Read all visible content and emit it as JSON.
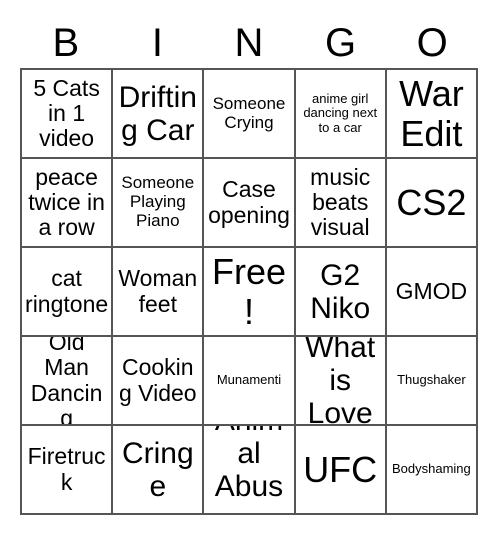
{
  "header": {
    "letters": [
      "B",
      "I",
      "N",
      "G",
      "O"
    ]
  },
  "colors": {
    "border": "#555555",
    "text": "#000000",
    "background": "#ffffff"
  },
  "grid": {
    "rows": 5,
    "columns": 5,
    "cells": [
      {
        "text": "5 Cats in 1 video",
        "size": "s-md"
      },
      {
        "text": "Drifting Car",
        "size": "s-lg"
      },
      {
        "text": "Someone Crying",
        "size": "s-sm"
      },
      {
        "text": "anime girl dancing next to a car",
        "size": "s-xs"
      },
      {
        "text": "War Edit",
        "size": "s-xl"
      },
      {
        "text": "peace twice in a row",
        "size": "s-md"
      },
      {
        "text": "Someone Playing Piano",
        "size": "s-sm"
      },
      {
        "text": "Case opening",
        "size": "s-md"
      },
      {
        "text": "music beats visual",
        "size": "s-md"
      },
      {
        "text": "CS2",
        "size": "s-xl"
      },
      {
        "text": "cat ringtone",
        "size": "s-md"
      },
      {
        "text": "Woman feet",
        "size": "s-md"
      },
      {
        "text": "Free!",
        "size": "s-xl"
      },
      {
        "text": "G2 Niko",
        "size": "s-lg"
      },
      {
        "text": "GMOD",
        "size": "s-md"
      },
      {
        "text": "Old Man Dancing",
        "size": "s-md"
      },
      {
        "text": "Cooking Video",
        "size": "s-md"
      },
      {
        "text": "Munamenti",
        "size": "s-xs"
      },
      {
        "text": "What is Love",
        "size": "s-lg"
      },
      {
        "text": "Thugshaker",
        "size": "s-xs"
      },
      {
        "text": "Firetruck",
        "size": "s-md"
      },
      {
        "text": "Cringe",
        "size": "s-lg"
      },
      {
        "text": "Animal Abuse",
        "size": "s-lg"
      },
      {
        "text": "UFC",
        "size": "s-xl"
      },
      {
        "text": "Bodyshaming",
        "size": "s-xs"
      }
    ]
  }
}
